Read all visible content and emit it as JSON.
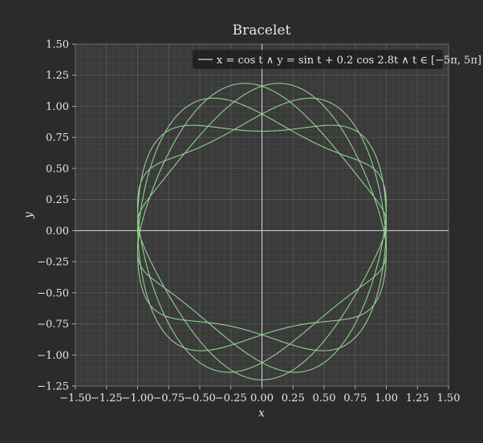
{
  "chart_data": {
    "type": "line",
    "title": "Bracelet",
    "xlabel": "x",
    "ylabel": "y",
    "xlim": [
      -1.5,
      1.5
    ],
    "ylim": [
      -1.25,
      1.5
    ],
    "xticks": [
      -1.5,
      -1.25,
      -1.0,
      -0.75,
      -0.5,
      -0.25,
      0.0,
      0.25,
      0.5,
      0.75,
      1.0,
      1.25,
      1.5
    ],
    "xtick_labels": [
      "−1.50",
      "−1.25",
      "−1.00",
      "−0.75",
      "−0.50",
      "−0.25",
      "0.00",
      "0.25",
      "0.50",
      "0.75",
      "1.00",
      "1.25",
      "1.50"
    ],
    "yticks": [
      -1.25,
      -1.0,
      -0.75,
      -0.5,
      -0.25,
      0.0,
      0.25,
      0.5,
      0.75,
      1.0,
      1.25,
      1.5
    ],
    "ytick_labels": [
      "−1.25",
      "−1.00",
      "−0.75",
      "−0.50",
      "−0.25",
      "0.00",
      "0.25",
      "0.50",
      "0.75",
      "1.00",
      "1.25",
      "1.50"
    ],
    "grid": true,
    "legend_position": "top-right",
    "series": [
      {
        "name": "x = cos t ∧ y = sin t + 0.2 cos 2.8t ∧ t ∈ [−5π, 5π]",
        "parametric": {
          "x": "cos(t)",
          "y": "sin(t) + 0.2*cos(2.8*t)",
          "t_range": [
            "-5π",
            "5π"
          ]
        },
        "color": "#8fd18f"
      }
    ]
  },
  "colors": {
    "background": "#2b2b2b",
    "plot_background": "#3a3a3a",
    "grid_major": "#6a6a6a",
    "grid_minor": "#4a4a4a",
    "zero_axis": "#d8d8d8",
    "text": "#e6e6e6",
    "series": "#8fd18f"
  }
}
